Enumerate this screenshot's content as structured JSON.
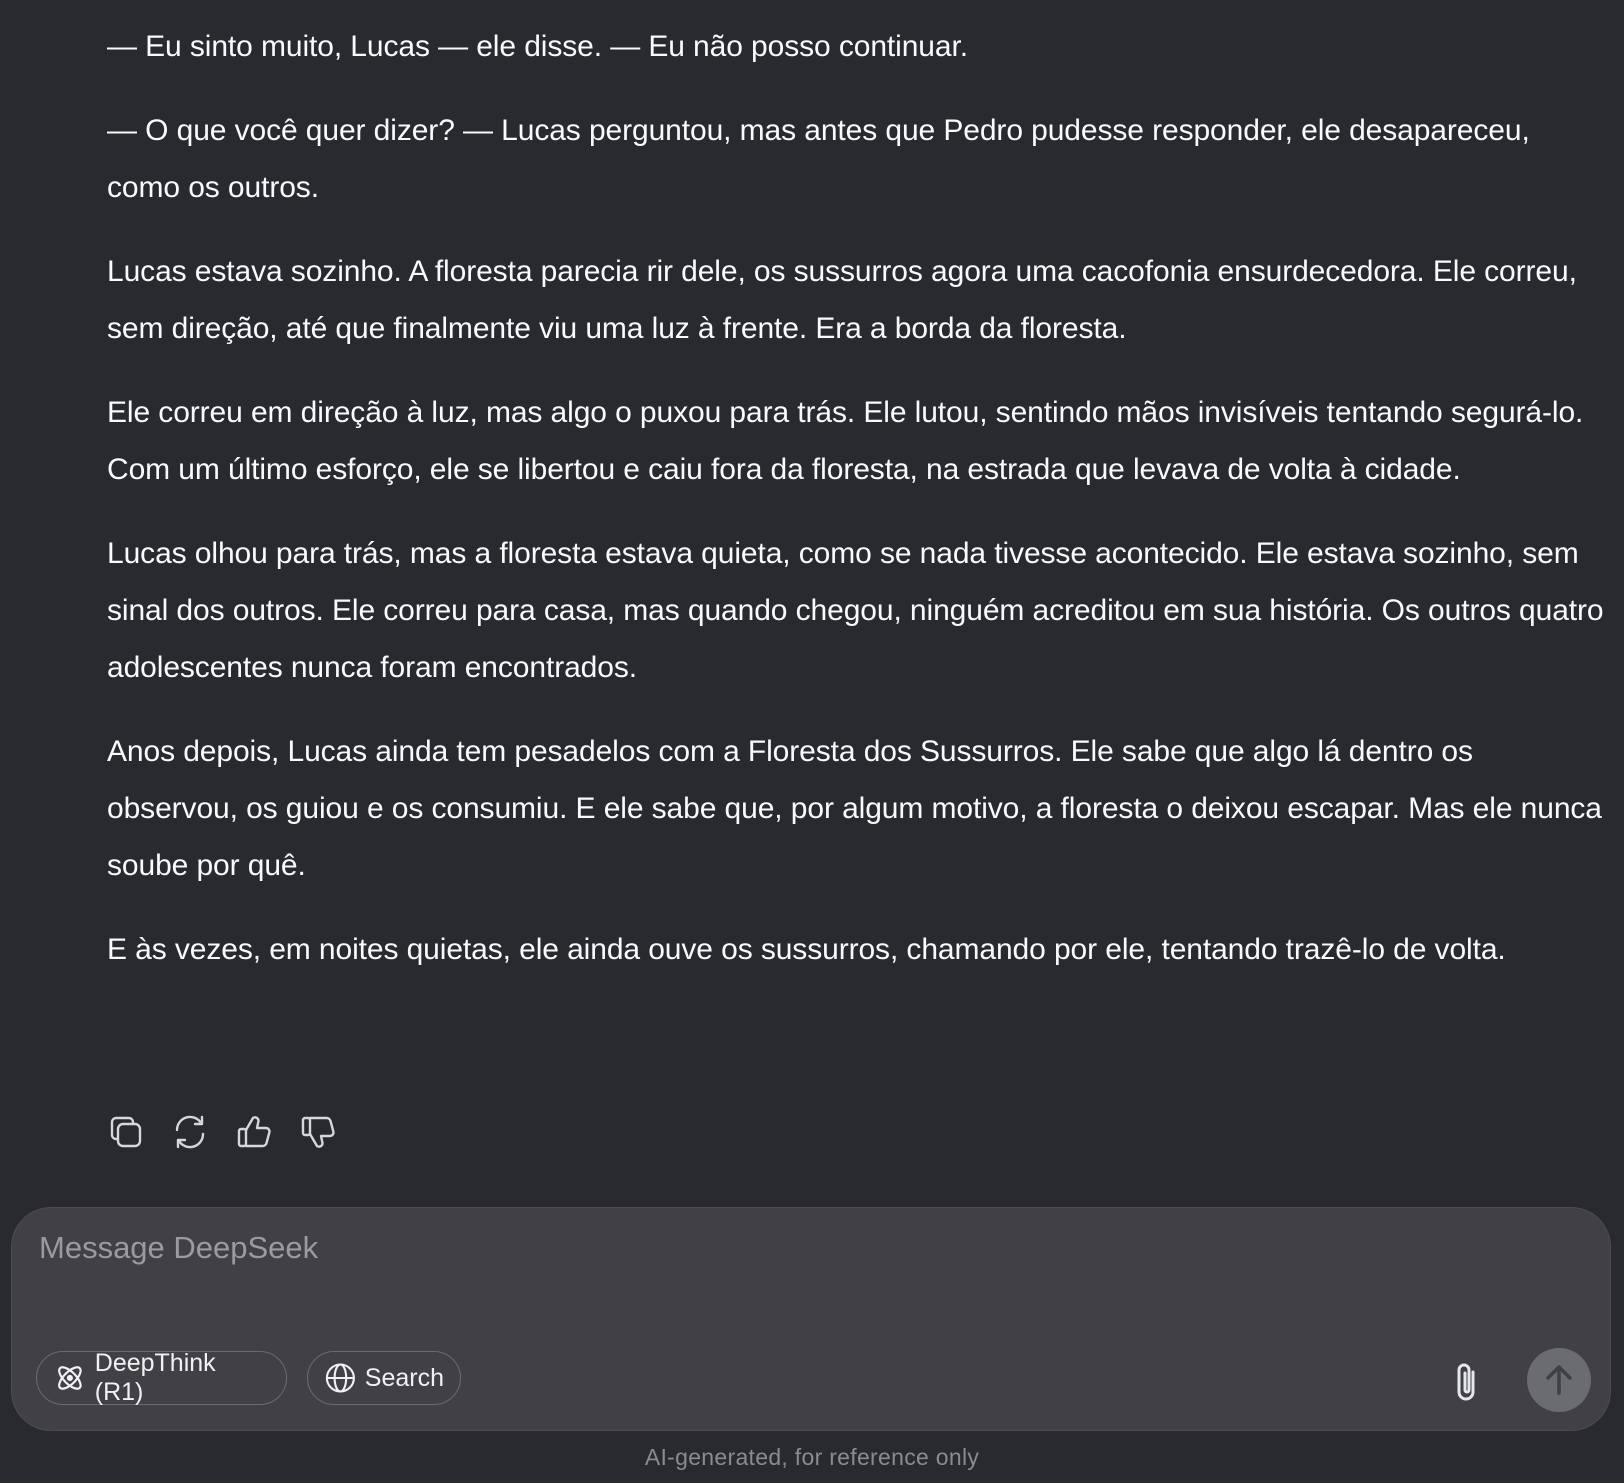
{
  "message": {
    "paragraphs": [
      "— Eu sinto muito, Lucas — ele disse. — Eu não posso continuar.",
      "— O que você quer dizer? — Lucas perguntou, mas antes que Pedro pudesse responder, ele desapareceu, como os outros.",
      "Lucas estava sozinho. A floresta parecia rir dele, os sussurros agora uma cacofonia ensurdecedora. Ele correu, sem direção, até que finalmente viu uma luz à frente. Era a borda da floresta.",
      "Ele correu em direção à luz, mas algo o puxou para trás. Ele lutou, sentindo mãos invisíveis tentando segurá-lo. Com um último esforço, ele se libertou e caiu fora da floresta, na estrada que levava de volta à cidade.",
      "Lucas olhou para trás, mas a floresta estava quieta, como se nada tivesse acontecido. Ele estava sozinho, sem sinal dos outros. Ele correu para casa, mas quando chegou, ninguém acreditou em sua história. Os outros quatro adolescentes nunca foram encontrados.",
      "Anos depois, Lucas ainda tem pesadelos com a Floresta dos Sussurros. Ele sabe que algo lá dentro os observou, os guiou e os consumiu. E ele sabe que, por algum motivo, a floresta o deixou escapar. Mas ele nunca soube por quê.",
      "E às vezes, em noites quietas, ele ainda ouve os sussurros, chamando por ele, tentando trazê-lo de volta."
    ]
  },
  "actions": {
    "icons": [
      "copy-icon",
      "regenerate-icon",
      "thumbs-up-icon",
      "thumbs-down-icon"
    ]
  },
  "composer": {
    "placeholder": "Message DeepSeek",
    "deepthink_label": "DeepThink (R1)",
    "search_label": "Search"
  },
  "footer": {
    "disclaimer": "AI-generated, for reference only"
  },
  "colors": {
    "background": "#292a2d",
    "composer_bg": "#404045",
    "text": "#f8faff",
    "muted": "#8a8b90"
  }
}
